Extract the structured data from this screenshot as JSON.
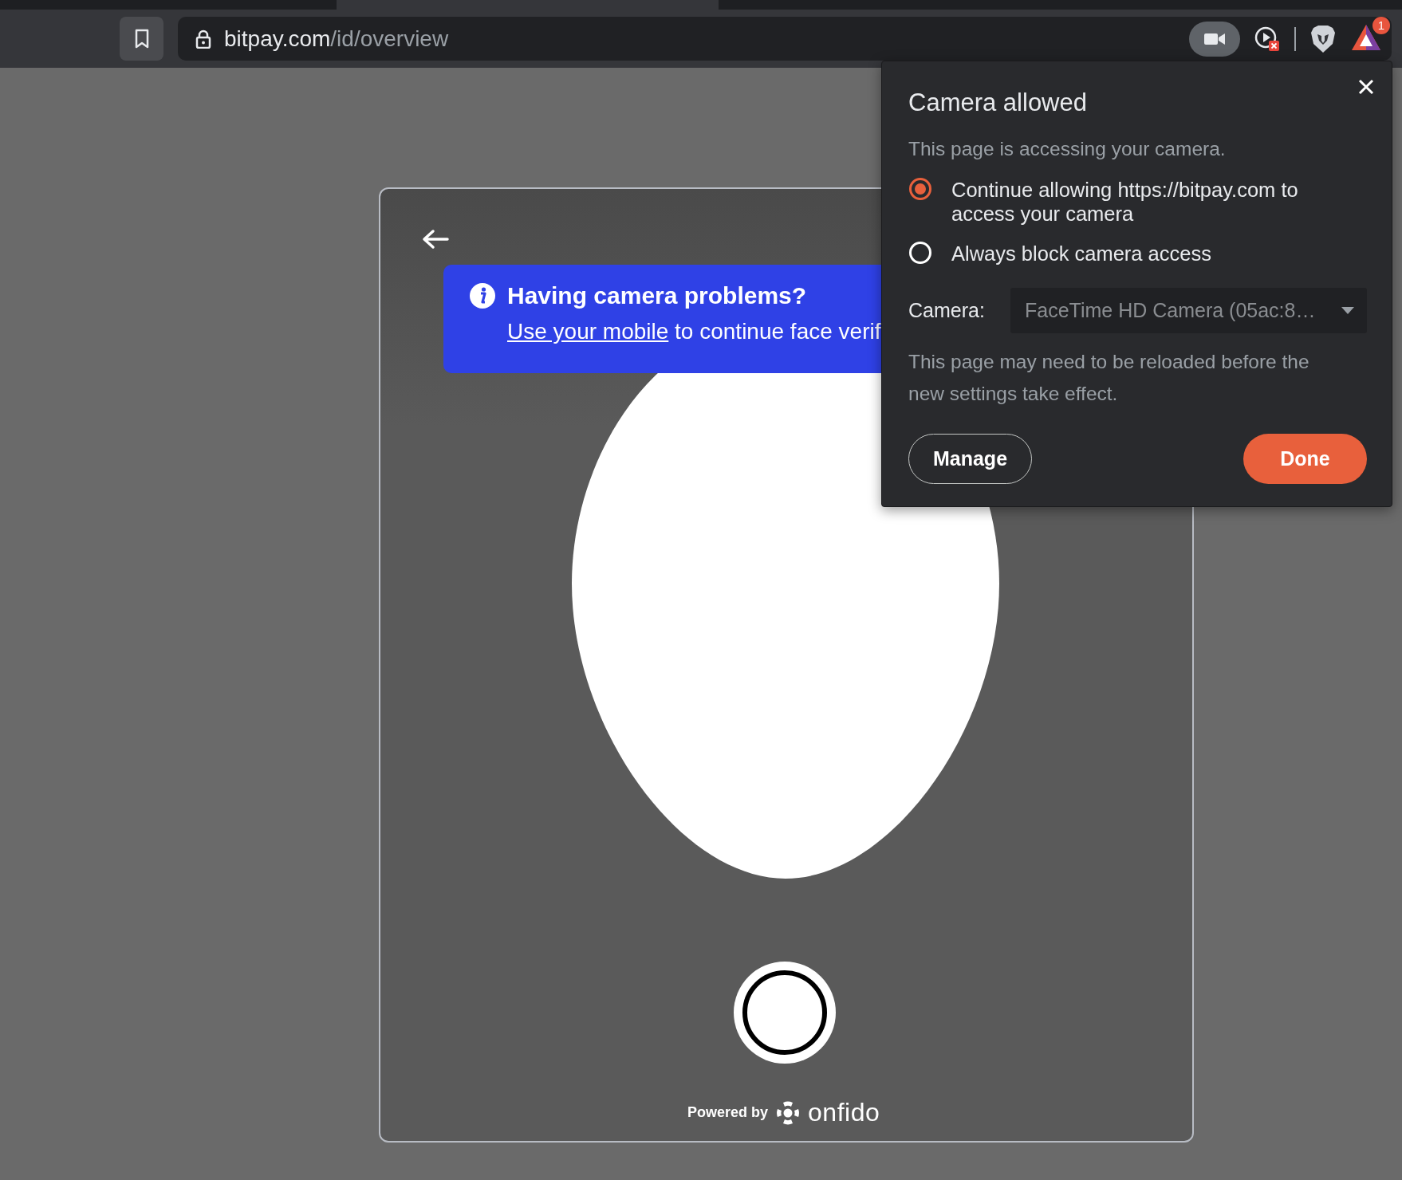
{
  "browser": {
    "url_host": "bitpay.com",
    "url_path": "/id/overview",
    "camera_active": true,
    "extension_badge": "1"
  },
  "card": {
    "banner": {
      "title": "Having camera problems?",
      "link": "Use your mobile",
      "message": "to continue face verif"
    },
    "powered_by": "Powered by",
    "brand": "onfido"
  },
  "popup": {
    "title": "Camera allowed",
    "subtitle": "This page is accessing your camera.",
    "options": [
      {
        "label": "Continue allowing https://bitpay.com to access your camera",
        "selected": true
      },
      {
        "label": "Always block camera access",
        "selected": false
      }
    ],
    "camera_label": "Camera:",
    "camera_value": "FaceTime HD Camera (05ac:8…",
    "note": "This page may need to be reloaded before the new settings take effect.",
    "buttons": [
      {
        "label": "Manage",
        "kind": "secondary"
      },
      {
        "label": "Done",
        "kind": "primary"
      }
    ]
  }
}
